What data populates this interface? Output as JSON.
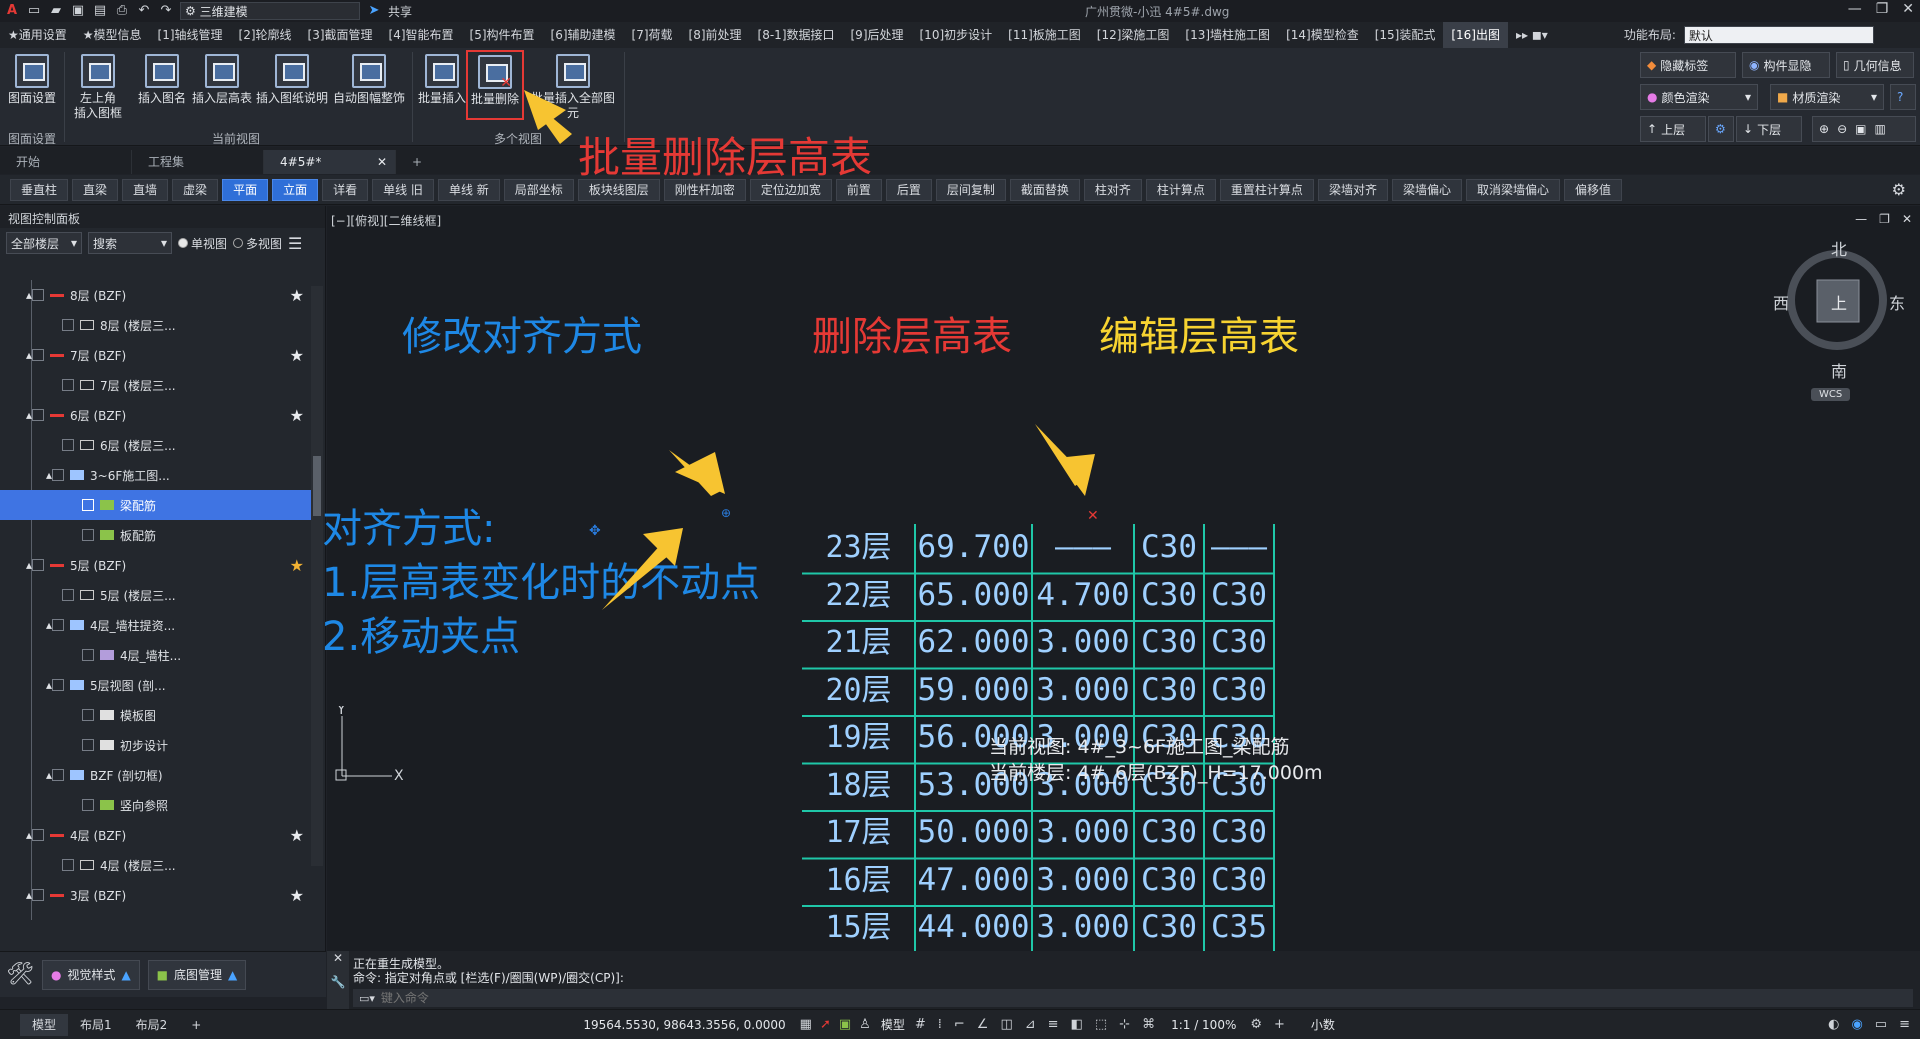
{
  "titlebar": {
    "workspace": "三维建模",
    "share": "共享",
    "title": "广州贯微-小迅   4#5#.dwg"
  },
  "menu": [
    "★通用设置",
    "★模型信息",
    "[1]轴线管理",
    "[2]轮廓线",
    "[3]截面管理",
    "[4]智能布置",
    "[5]构件布置",
    "[6]辅助建模",
    "[7]荷载",
    "[8]前处理",
    "[8-1]数据接口",
    "[9]后处理",
    "[10]初步设计",
    "[11]板施工图",
    "[12]梁施工图",
    "[13]墙柱施工图",
    "[14]模型检查",
    "[15]装配式",
    "[16]出图"
  ],
  "menu_right": {
    "layout_label": "功能布局:",
    "layout_value": "默认"
  },
  "ribbon": {
    "buttons": [
      "图面设置",
      "左上角\n插入图框",
      "插入图名",
      "插入层高表",
      "插入图纸说明",
      "自动图幅整饰",
      "批量插入",
      "批量删除",
      "批量插入全部图元"
    ],
    "groups": [
      "图面设置",
      "当前视图",
      "多个视图"
    ],
    "right": {
      "hide_label": "隐藏标签",
      "comp_display": "构件显隐",
      "geo_info": "几何信息",
      "color_render": "颜色渲染",
      "material_render": "材质渲染",
      "up_floor": "上层",
      "down_floor": "下层"
    }
  },
  "annotations": {
    "ribbon_callout": "批量删除层高表",
    "align": "修改对齐方式",
    "delete": "删除层高表",
    "edit": "编辑层高表",
    "align_desc": [
      "对齐方式:",
      "1.层高表变化时的不动点",
      "2.移动夹点"
    ]
  },
  "tabs": [
    "开始",
    "工程集",
    "4#5#*"
  ],
  "toolbar2": [
    "垂直柱",
    "直梁",
    "直墙",
    "虚梁",
    "平面",
    "立面",
    "详看",
    "单线 旧",
    "单线 新",
    "局部坐标",
    "板块线图层",
    "刚性杆加密",
    "定位边加宽",
    "前置",
    "后置",
    "层间复制",
    "截面替换",
    "柱对齐",
    "柱计算点",
    "重置柱计算点",
    "梁墙对齐",
    "梁墙偏心",
    "取消梁墙偏心",
    "偏移值"
  ],
  "panel": {
    "title": "视图控制面板",
    "filter": "全部楼层",
    "search": "搜索",
    "single": "单视图",
    "multi": "多视图",
    "tree": [
      "8层 (BZF)",
      "8层 (楼层三...",
      "7层 (BZF)",
      "7层 (楼层三...",
      "6层 (BZF)",
      "6层 (楼层三...",
      "3~6F施工图...",
      "梁配筋",
      "板配筋",
      "5层 (BZF)",
      "5层 (楼层三...",
      "4层_墙柱提资...",
      "4层_墙柱...",
      "5层视图 (剖...",
      "模板图",
      "初步设计",
      "BZF (剖切框)",
      "竖向参照",
      "4层 (BZF)",
      "4层 (楼层三...",
      "3层 (BZF)"
    ],
    "bottom": {
      "view_style": "视觉样式",
      "base_mgmt": "底图管理"
    }
  },
  "canvas": {
    "view_label": "[−][俯视][二维线框]",
    "compass": {
      "n": "北",
      "s": "南",
      "e": "东",
      "w": "西",
      "top": "上",
      "wcs": "WCS"
    },
    "overlay": [
      "当前视图: 4#_3~6F施工图_梁配筋",
      "当前楼层: 4#_6层(BZF)_H=17.000m"
    ]
  },
  "floor_table": [
    [
      "23层",
      "69.700",
      "———",
      "C30",
      "———"
    ],
    [
      "22层",
      "65.000",
      "4.700",
      "C30",
      "C30"
    ],
    [
      "21层",
      "62.000",
      "3.000",
      "C30",
      "C30"
    ],
    [
      "20层",
      "59.000",
      "3.000",
      "C30",
      "C30"
    ],
    [
      "19层",
      "56.000",
      "3.000",
      "C30",
      "C30"
    ],
    [
      "18层",
      "53.000",
      "3.000",
      "C30",
      "C30"
    ],
    [
      "17层",
      "50.000",
      "3.000",
      "C30",
      "C30"
    ],
    [
      "16层",
      "47.000",
      "3.000",
      "C30",
      "C30"
    ],
    [
      "15层",
      "44.000",
      "3.000",
      "C30",
      "C35"
    ]
  ],
  "command": {
    "line1": "正在重生成模型。",
    "line2": "命令: 指定对角点或 [栏选(F)/圈围(WP)/圈交(CP)]:",
    "placeholder": "键入命令"
  },
  "status": {
    "tabs": [
      "模型",
      "布局1",
      "布局2"
    ],
    "coords": "19564.5530, 98643.3556, 0.0000",
    "mode": "模型",
    "scale": "1:1 / 100%",
    "units": "小数"
  },
  "colors": {
    "accent": "#3f74e3",
    "callout_red": "#e53935",
    "callout_blue": "#1e88e5",
    "callout_yellow": "#f7d331",
    "table_grid": "#1fc7a8",
    "table_text": "#9fd0ff"
  }
}
